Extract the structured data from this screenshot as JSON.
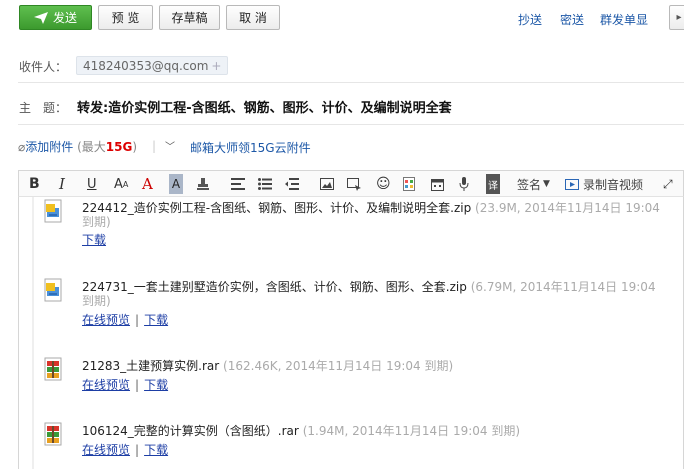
{
  "toolbar": {
    "send": "发送",
    "preview": "预 览",
    "draft": "存草稿",
    "cancel": "取 消",
    "cc": "抄送",
    "bcc": "密送",
    "separate": "群发单显"
  },
  "recipients": {
    "label": "收件人：",
    "items": [
      "418240353@qq.com"
    ]
  },
  "subject": {
    "label": "主　题：",
    "value": "转发:造价实例工程-含图纸、钢筋、图形、计价、及编制说明全套"
  },
  "attach": {
    "add_label": "添加附件",
    "max_prefix": "(最大",
    "max_size": "15G",
    "max_suffix": ")",
    "cloud_label": "邮箱大师领15G云附件"
  },
  "editor_toolbar": {
    "signature": "签名",
    "record_video": "录制音视频"
  },
  "attachments": [
    {
      "name": "224412_造价实例工程-含图纸、钢筋、图形、计价、及编制说明全套.zip",
      "meta": "(23.9M, 2014年11月14日 19:04",
      "meta_wrap": "到期)",
      "icon": "zip-file-icon",
      "actions": [
        "下载"
      ]
    },
    {
      "name": "224731_一套土建别墅造价实例，含图纸、计价、钢筋、图形、全套.zip",
      "meta": "(6.79M, 2014年11月14日 19:04",
      "meta_wrap": "到期)",
      "icon": "zip-file-icon",
      "actions": [
        "在线预览",
        "下载"
      ]
    },
    {
      "name": "21283_土建预算实例.rar",
      "meta": "(162.46K, 2014年11月14日 19:04 到期)",
      "meta_wrap": "",
      "icon": "rar-file-icon",
      "actions": [
        "在线预览",
        "下载"
      ]
    },
    {
      "name": "106124_完整的计算实例（含图纸）.rar",
      "meta": "(1.94M, 2014年11月14日 19:04 到期)",
      "meta_wrap": "",
      "icon": "rar-file-icon",
      "actions": [
        "在线预览",
        "下载"
      ]
    }
  ],
  "colors": {
    "send_button": "#46a636",
    "link": "#1d58a7",
    "size_highlight": "#dd0000"
  }
}
